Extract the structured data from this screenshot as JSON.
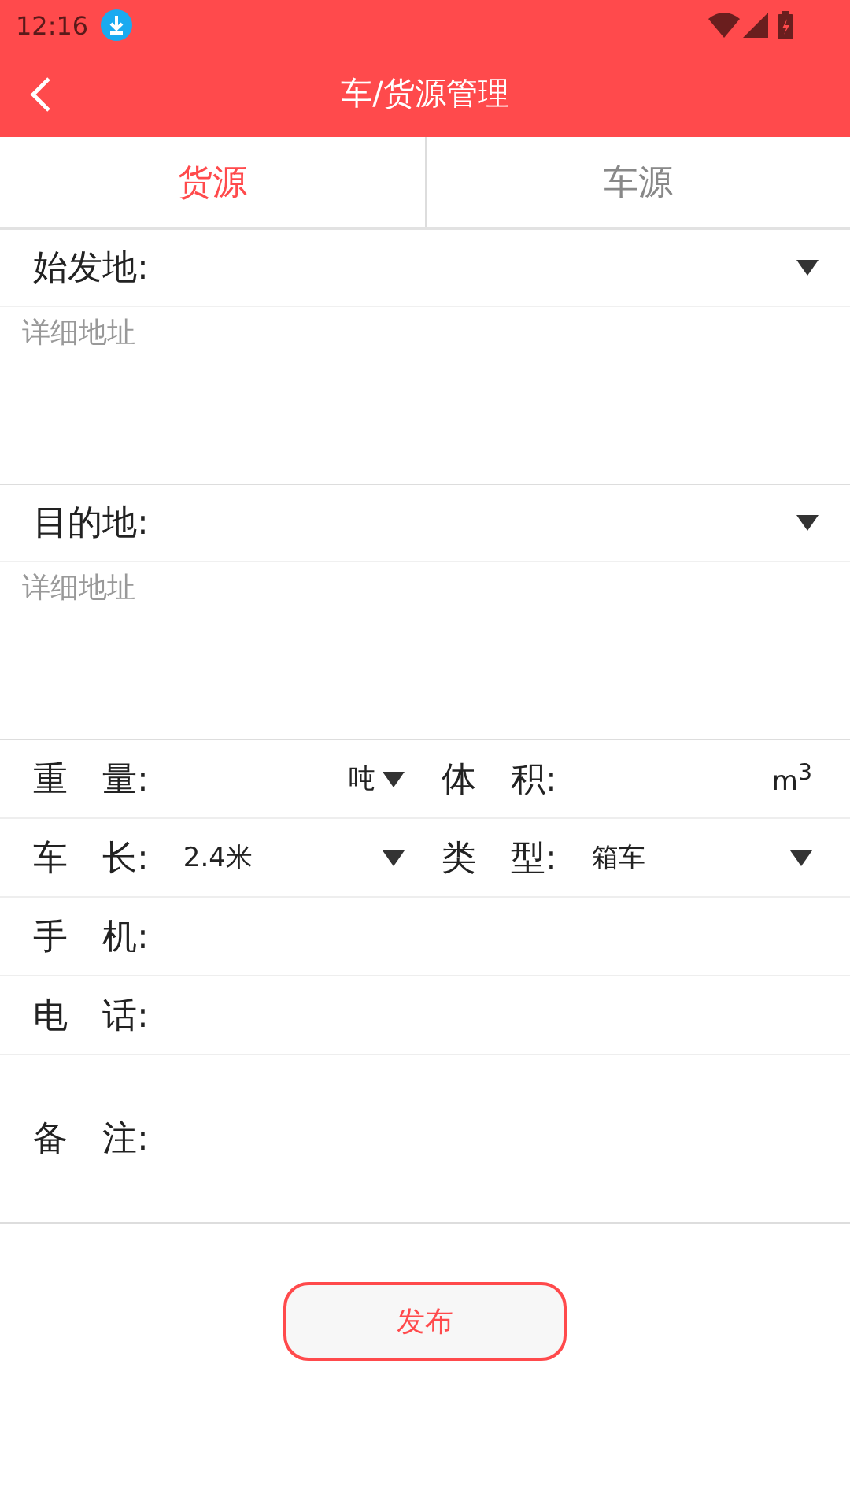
{
  "status_bar": {
    "time": "12:16"
  },
  "header": {
    "title": "车/货源管理"
  },
  "tabs": [
    {
      "label": "货源",
      "selected": true
    },
    {
      "label": "车源",
      "selected": false
    }
  ],
  "addresses": [
    {
      "label": "始发地:",
      "placeholder": "详细地址"
    },
    {
      "label": "目的地:",
      "placeholder": "详细地址"
    }
  ],
  "rows": [
    {
      "kind": "pair",
      "cells": [
        {
          "label": "重　量:",
          "unit": "吨",
          "dropdown": true
        },
        {
          "label": "体　积:",
          "unit": "m$^{3}$",
          "dropdown": false
        }
      ]
    },
    {
      "kind": "pair",
      "cells": [
        {
          "label": "车　长:",
          "value": "2.4米",
          "dropdown": true
        },
        {
          "label": "类　型:",
          "value": "箱车",
          "dropdown": true
        }
      ]
    },
    {
      "kind": "single",
      "label": "手　机:"
    },
    {
      "kind": "single",
      "label": "电　话:"
    },
    {
      "kind": "note",
      "label": "备　注:"
    }
  ],
  "submit": {
    "label": "发布"
  }
}
